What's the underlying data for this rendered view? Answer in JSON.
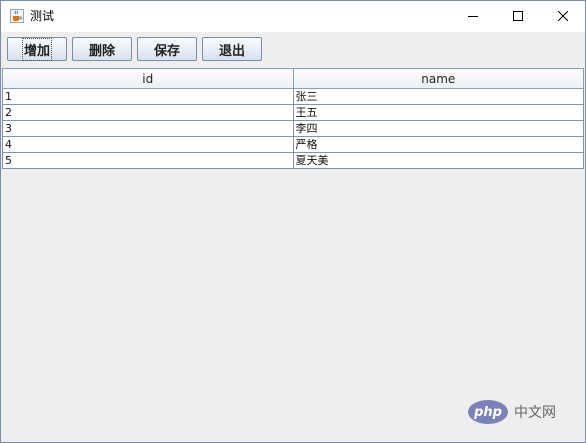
{
  "window": {
    "title": "测试",
    "app_icon": "java-cup-icon",
    "controls": [
      "minimize-icon",
      "maximize-icon",
      "close-icon"
    ]
  },
  "toolbar": {
    "add_label": "增加",
    "delete_label": "删除",
    "save_label": "保存",
    "exit_label": "退出"
  },
  "table": {
    "columns": [
      "id",
      "name"
    ],
    "rows": [
      [
        "1",
        "张三"
      ],
      [
        "2",
        "王五"
      ],
      [
        "3",
        "李四"
      ],
      [
        "4",
        "严格"
      ],
      [
        "5",
        "夏天美"
      ]
    ]
  },
  "watermark": {
    "logo_text": "php",
    "site_text": "中文网"
  },
  "colors": {
    "window_bg": "#eeeeee",
    "border": "#7a8ea8",
    "watermark": "#7b82b8"
  }
}
